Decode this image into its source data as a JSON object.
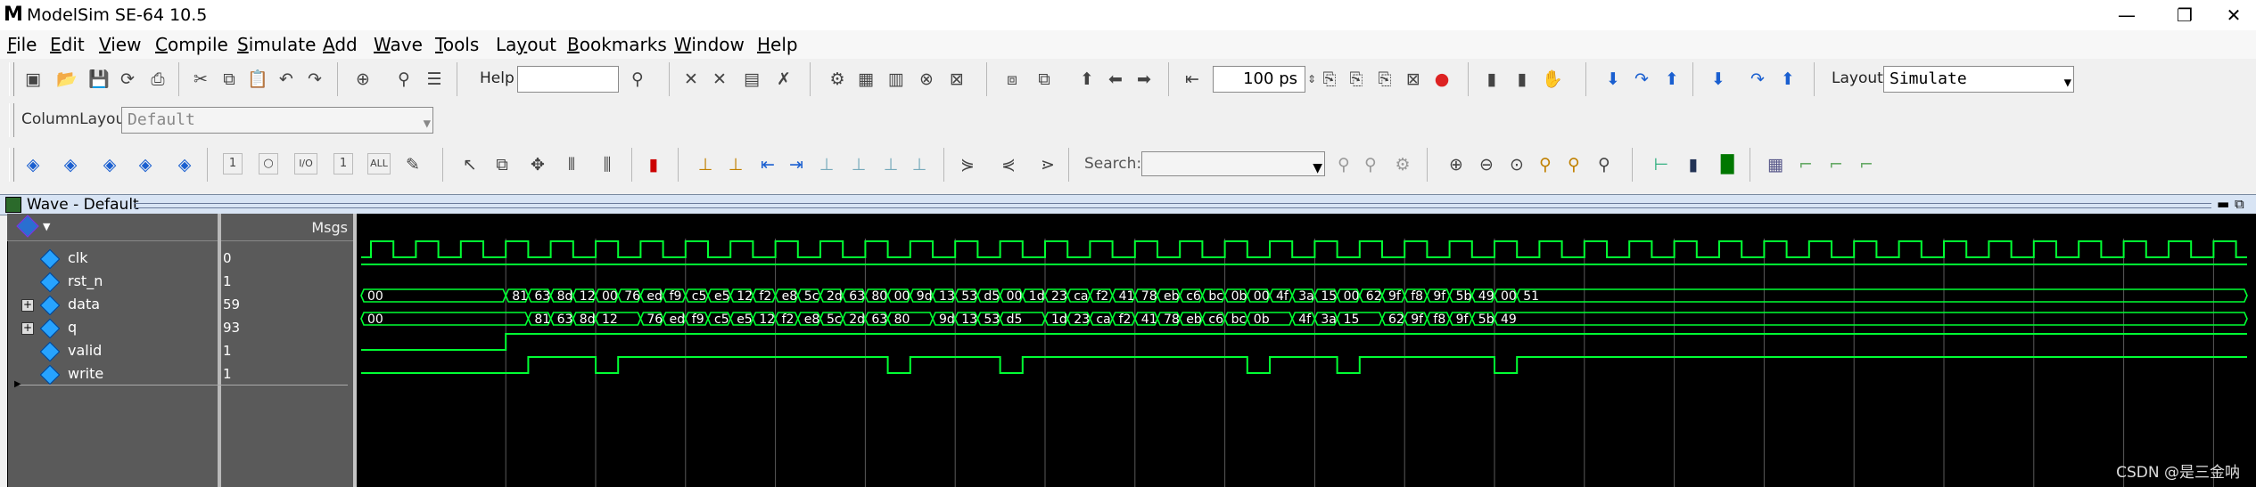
{
  "window": {
    "logo": "M",
    "title": "ModelSim SE-64 10.5",
    "controls": [
      "—",
      "❐",
      "✕"
    ]
  },
  "menu": [
    {
      "label": "File",
      "u": "F",
      "rest": "ile"
    },
    {
      "label": "Edit",
      "u": "E",
      "rest": "dit"
    },
    {
      "label": "View",
      "u": "V",
      "rest": "iew"
    },
    {
      "label": "Compile",
      "u": "C",
      "rest": "ompile"
    },
    {
      "label": "Simulate",
      "u": "S",
      "rest": "imulate"
    },
    {
      "label": "Add",
      "u": "A",
      "rest": "dd"
    },
    {
      "label": "Wave",
      "u": "W",
      "rest": "ave"
    },
    {
      "label": "Tools",
      "u": "T",
      "rest": "ools"
    },
    {
      "label": "Layout",
      "u": "y",
      "rest": ""
    },
    {
      "label": "Bookmarks",
      "u": "B",
      "rest": "ookmarks"
    },
    {
      "label": "Window",
      "u": "W",
      "rest": "indow"
    },
    {
      "label": "Help",
      "u": "H",
      "rest": "elp"
    }
  ],
  "toolbar": {
    "help_label": "Help",
    "help_value": "",
    "run_length": "100 ps",
    "layout_label": "Layout",
    "layout_value": "Simulate",
    "column_layout_label": "ColumnLayout",
    "column_layout_value": "Default",
    "search_label": "Search:",
    "search_value": ""
  },
  "wave_window": {
    "title": "Wave - Default",
    "msgs_header": "Msgs",
    "signals": [
      {
        "name": "clk",
        "value": "0",
        "expandable": false
      },
      {
        "name": "rst_n",
        "value": "1",
        "expandable": false
      },
      {
        "name": "data",
        "value": "59",
        "expandable": true
      },
      {
        "name": "q",
        "value": "93",
        "expandable": true
      },
      {
        "name": "valid",
        "value": "1",
        "expandable": false
      },
      {
        "name": "write",
        "value": "1",
        "expandable": false
      }
    ],
    "data_bus": [
      "00",
      "81",
      "63",
      "8d",
      "12",
      "00",
      "76",
      "ed",
      "f9",
      "c5",
      "e5",
      "12",
      "f2",
      "e8",
      "5c",
      "2d",
      "63",
      "80",
      "00",
      "9d",
      "13",
      "53",
      "d5",
      "00",
      "1d",
      "23",
      "ca",
      "f2",
      "41",
      "78",
      "eb",
      "c6",
      "bc",
      "0b",
      "00",
      "4f",
      "3a",
      "15",
      "00",
      "62",
      "9f",
      "f8",
      "9f",
      "5b",
      "49",
      "00",
      "51"
    ],
    "q_bus": [
      "00",
      "81",
      "63",
      "8d",
      "12",
      "76",
      "ed",
      "f9",
      "c5",
      "e5",
      "12",
      "f2",
      "e8",
      "5c",
      "2d",
      "63",
      "80",
      "9d",
      "13",
      "53",
      "d5",
      "1d",
      "23",
      "ca",
      "f2",
      "41",
      "78",
      "eb",
      "c6",
      "bc",
      "0b",
      "4f",
      "3a",
      "15",
      "62",
      "9f",
      "f8",
      "9f",
      "5b",
      "49"
    ]
  },
  "colors": {
    "waveform": "#00ff33",
    "bus_text": "#ffffff",
    "background": "#000000",
    "cursor_line": "#8a8a8a"
  },
  "watermark": "CSDN @是三金呐"
}
